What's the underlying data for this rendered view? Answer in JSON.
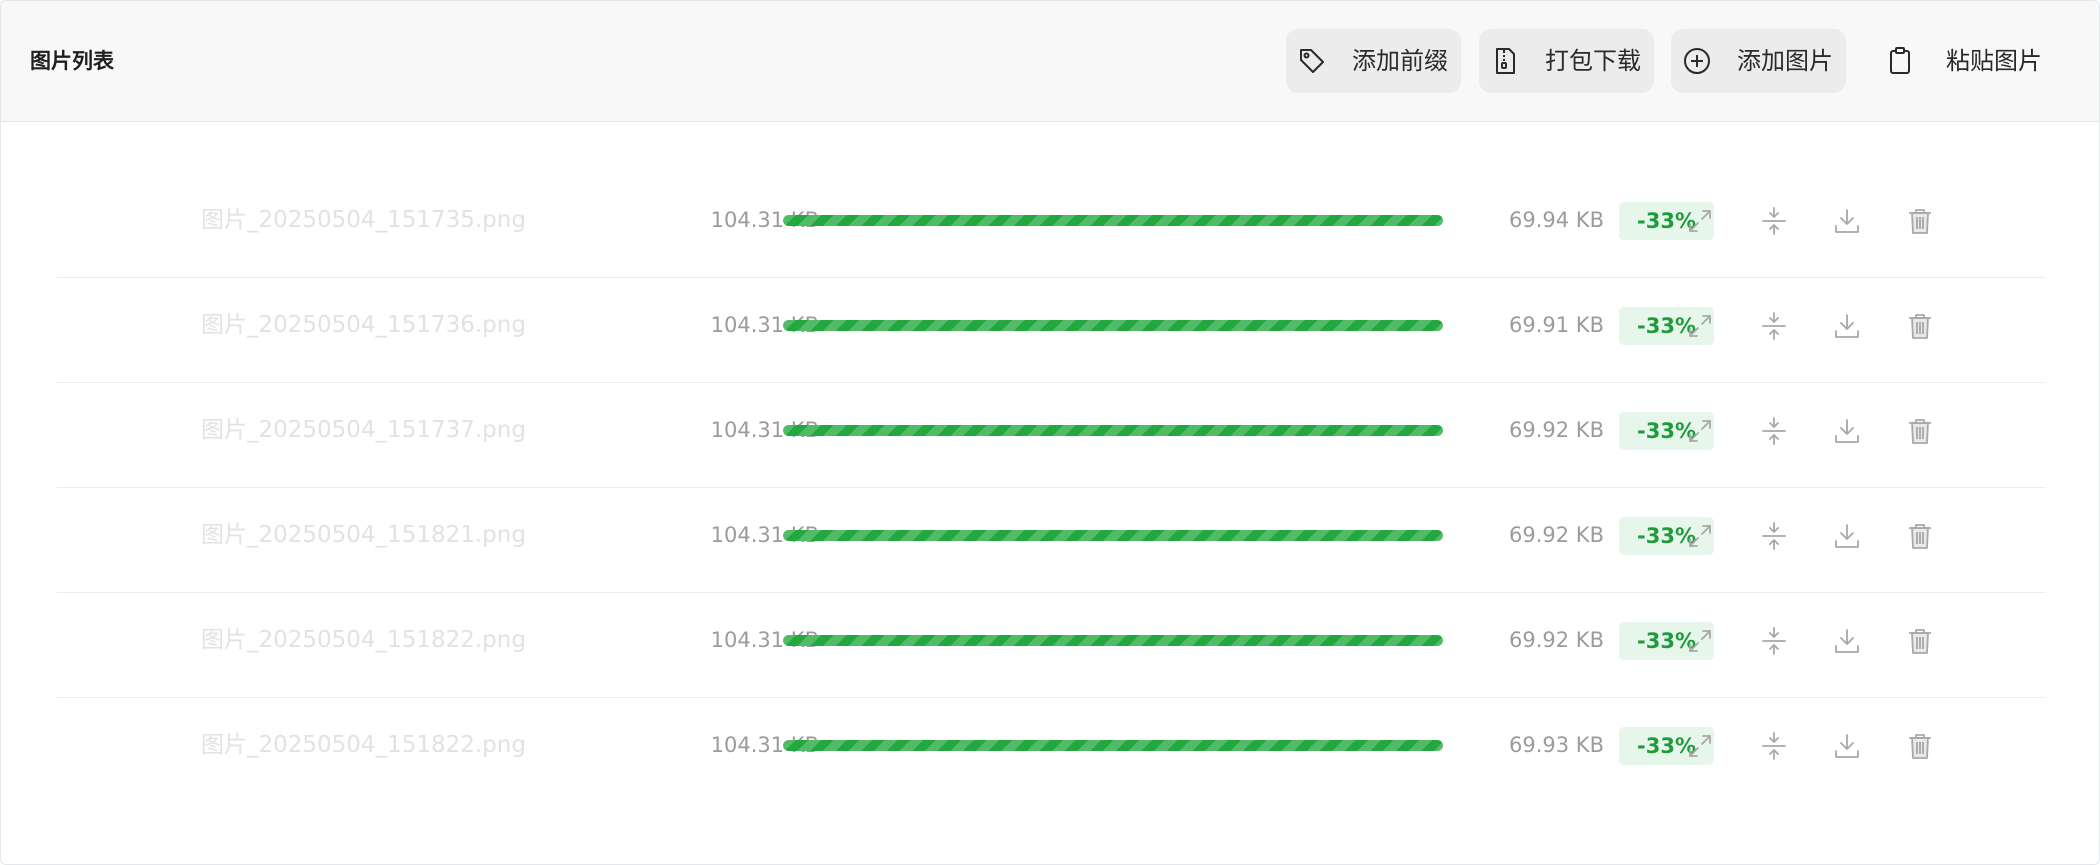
{
  "header": {
    "title": "图片列表",
    "buttons": [
      {
        "id": "add-prefix",
        "label": "添加前缀",
        "icon": "tag-icon"
      },
      {
        "id": "zip-download",
        "label": "打包下载",
        "icon": "zip-file-icon"
      },
      {
        "id": "add-image",
        "label": "添加图片",
        "icon": "plus-circle-icon"
      },
      {
        "id": "paste-image",
        "label": "粘贴图片",
        "icon": "clipboard-icon"
      }
    ]
  },
  "colors": {
    "accent": "#22a83e",
    "badge_bg": "#e6f6ea",
    "badge_text": "#1f9a3c",
    "icon_gray": "#a8a8a8"
  },
  "row_actions": [
    "expand-icon",
    "compress-icon",
    "download-icon",
    "trash-icon"
  ],
  "files": [
    {
      "name": "图片_20250504_151735.png",
      "original_size": "104.31 KB",
      "progress": 1.0,
      "compressed_size": "69.94 KB",
      "ratio": "-33%"
    },
    {
      "name": "图片_20250504_151736.png",
      "original_size": "104.31 KB",
      "progress": 1.0,
      "compressed_size": "69.91 KB",
      "ratio": "-33%"
    },
    {
      "name": "图片_20250504_151737.png",
      "original_size": "104.31 KB",
      "progress": 1.0,
      "compressed_size": "69.92 KB",
      "ratio": "-33%"
    },
    {
      "name": "图片_20250504_151821.png",
      "original_size": "104.31 KB",
      "progress": 1.0,
      "compressed_size": "69.92 KB",
      "ratio": "-33%"
    },
    {
      "name": "图片_20250504_151822.png",
      "original_size": "104.31 KB",
      "progress": 1.0,
      "compressed_size": "69.92 KB",
      "ratio": "-33%"
    },
    {
      "name": "图片_20250504_151822.png",
      "original_size": "104.31 KB",
      "progress": 1.0,
      "compressed_size": "69.93 KB",
      "ratio": "-33%"
    }
  ]
}
